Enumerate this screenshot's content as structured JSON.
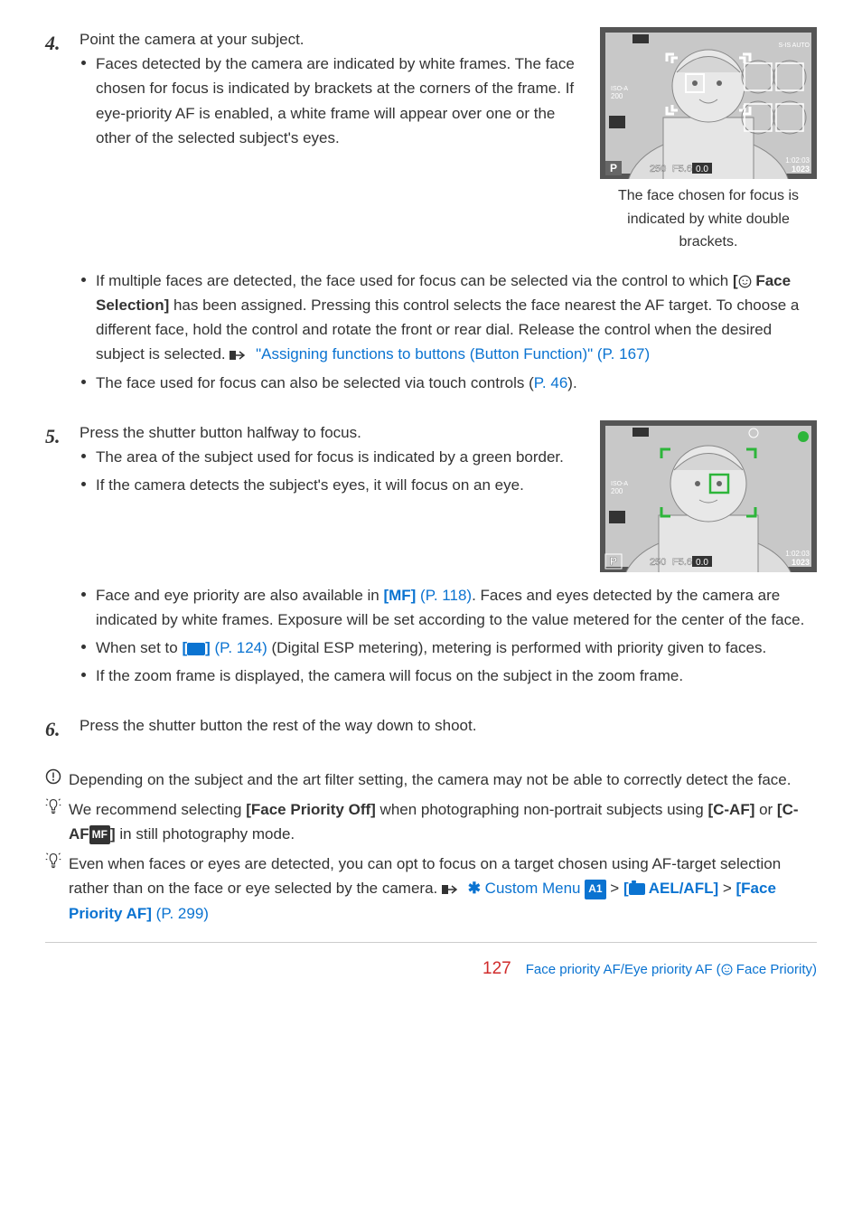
{
  "steps": {
    "s4": {
      "num": "4.",
      "intro": "Point the camera at your subject.",
      "bullets1": [
        "Faces detected by the camera are indicated by white frames. The face chosen for focus is indicated by brackets at the corners of the frame. If eye-priority AF is enabled, a white frame will appear over one or the other of the selected subject's eyes."
      ],
      "caption1": "The face chosen for focus is indicated by white double brackets.",
      "bullets2_a_pre": "If multiple faces are detected, the face used for focus can be selected via the control to which ",
      "bullets2_a_bold": "[",
      "bullets2_a_bold2": " Face Selection]",
      "bullets2_a_mid": " has been assigned. Pressing this control selects the face nearest the AF target. To choose a different face, hold the control and rotate the front or rear dial. Release the control when the desired subject is selected. ",
      "bullets2_a_link": "\"Assigning functions to buttons (Button Function)\" (P. 167)",
      "bullets2_b_pre": "The face used for focus can also be selected via touch controls (",
      "bullets2_b_link": "P. 46",
      "bullets2_b_post": ")."
    },
    "s5": {
      "num": "5.",
      "intro": "Press the shutter button halfway to focus.",
      "bullets1": [
        "The area of the subject used for focus is indicated by a green border.",
        "If the camera detects the subject's eyes, it will focus on an eye."
      ],
      "bullets2_a_pre": "Face and eye priority are also available in ",
      "bullets2_a_link": "[MF]",
      "bullets2_a_link2": " (P. 118)",
      "bullets2_a_post": ". Faces and eyes detected by the camera are indicated by white frames. Exposure will be set according to the value metered for the center of the face.",
      "bullets2_b_pre": "When set to ",
      "bullets2_b_link2": " (P. 124)",
      "bullets2_b_post": " (Digital ESP metering), metering is performed with priority given to faces.",
      "bullets2_c": "If the zoom frame is displayed, the camera will focus on the subject in the zoom frame."
    },
    "s6": {
      "num": "6.",
      "intro": "Press the shutter button the rest of the way down to shoot."
    }
  },
  "notes": {
    "n1": "Depending on the subject and the art filter setting, the camera may not be able to correctly detect the face.",
    "n2_pre": "We recommend selecting ",
    "n2_b1": "[Face Priority Off]",
    "n2_mid": " when photographing non-portrait subjects using ",
    "n2_b2": "[C-AF]",
    "n2_or": " or ",
    "n2_b3_pre": "[C-AF",
    "n2_b3_badge": "MF",
    "n2_b3_post": "]",
    "n2_tail": " in still photography mode.",
    "n3_pre": "Even when faces or eyes are detected, you can opt to focus on a target chosen using AF-target selection rather than on the face or eye selected by the camera. ",
    "n3_link1_pre": " Custom Menu ",
    "n3_link1_badge": "A1",
    "n3_link2_pre": "[",
    "n3_link2_mid": " AEL/AFL]",
    "n3_link3": "[Face Priority AF]",
    "n3_link4": " (P. 299)"
  },
  "footer": {
    "page": "127",
    "link": "Face priority AF/Eye priority AF (",
    "link2": " Face Priority)"
  },
  "screen1": {
    "p": "P",
    "shutter": "250",
    "fstop": "F5.6",
    "ev": "0.0",
    "iso_label": "ISO-A",
    "iso_val": "200",
    "time": "1:02:03",
    "shots": "1023",
    "wb": "S-IS AUTO"
  },
  "screen2": {
    "p": "P",
    "shutter": "250",
    "fstop": "F5.6",
    "ev": "0.0",
    "iso_label": "ISO-A",
    "iso_val": "200",
    "time": "1:02:03",
    "shots": "1023"
  }
}
